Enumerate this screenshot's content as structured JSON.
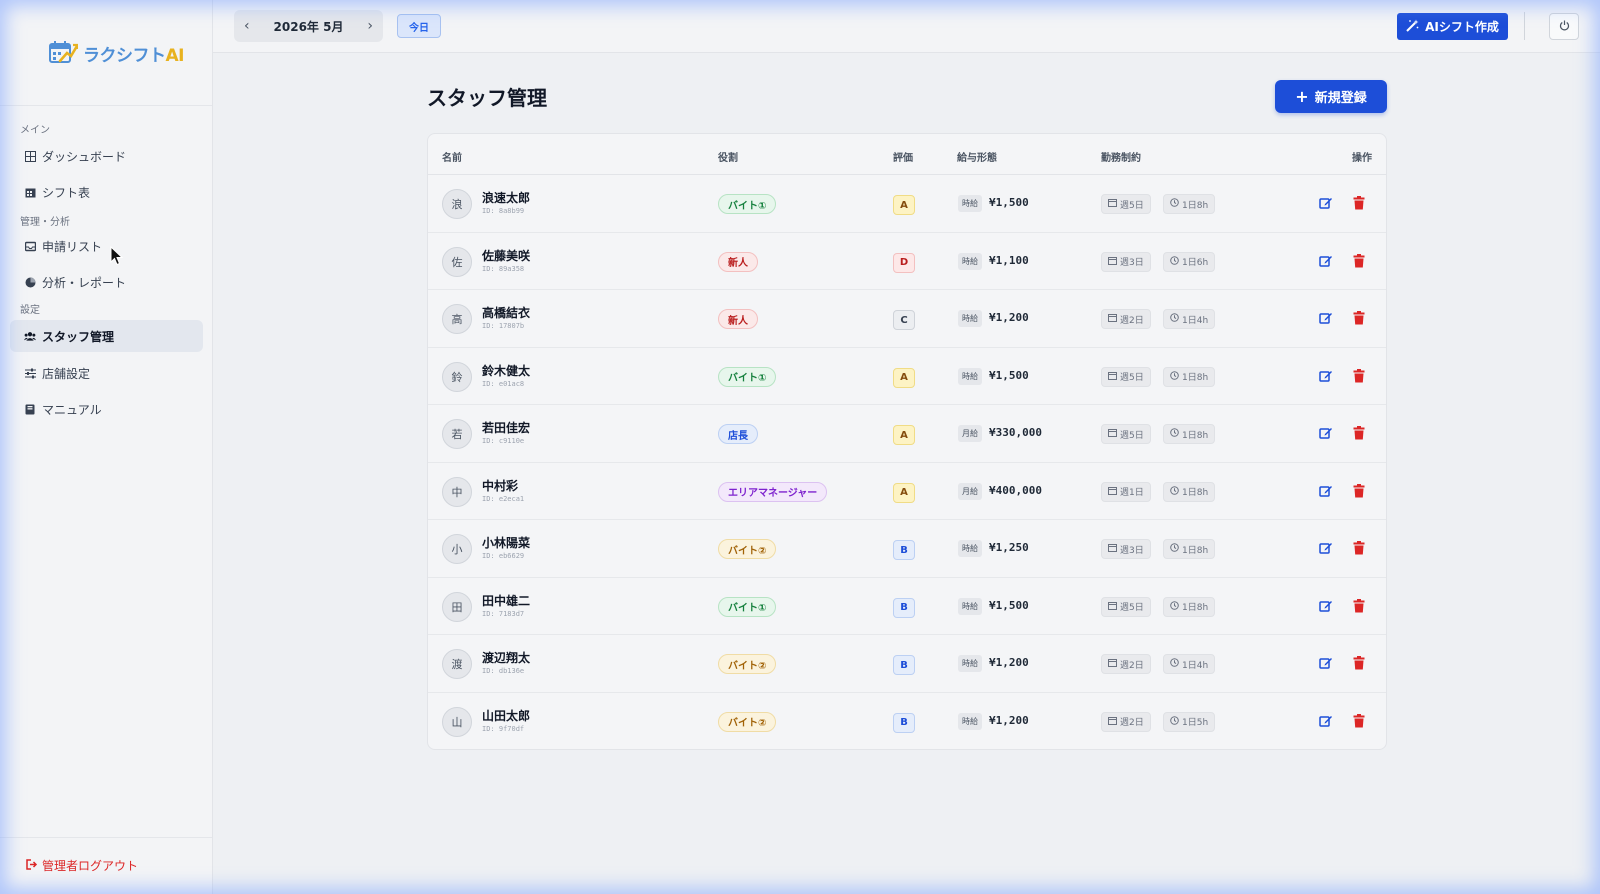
{
  "app": {
    "logo_text": "ラクシフト",
    "logo_ai": "AI"
  },
  "sidebar": {
    "sections": {
      "main": "メイン",
      "manage": "管理・分析",
      "settings": "設定"
    },
    "items": [
      {
        "label": "ダッシュボード",
        "icon": "dashboard-icon"
      },
      {
        "label": "シフト表",
        "icon": "calendar-icon"
      },
      {
        "label": "申請リスト",
        "icon": "inbox-icon"
      },
      {
        "label": "分析・レポート",
        "icon": "pie-chart-icon"
      },
      {
        "label": "スタッフ管理",
        "icon": "users-icon",
        "active": true
      },
      {
        "label": "店舗設定",
        "icon": "sliders-icon"
      },
      {
        "label": "マニュアル",
        "icon": "book-icon"
      }
    ],
    "logout": "管理者ログアウト"
  },
  "topbar": {
    "month": "2026年 5月",
    "today": "今日",
    "ai_button": "AIシフト作成",
    "power_icon": "power-icon"
  },
  "main": {
    "title": "スタッフ管理",
    "new_button": "新規登録",
    "columns": [
      "名前",
      "役割",
      "評価",
      "給与形態",
      "勤務制約",
      "操作"
    ],
    "rows": [
      {
        "initial": "浪",
        "name": "浪速太郎",
        "id": "ID: 8a8b99",
        "role": "バイト①",
        "role_style": "green",
        "grade": "A",
        "pay_type": "時給",
        "pay": "¥1,500",
        "days": "週5日",
        "hours": "1日8h"
      },
      {
        "initial": "佐",
        "name": "佐藤美咲",
        "id": "ID: 89a358",
        "role": "新人",
        "role_style": "red",
        "grade": "D",
        "pay_type": "時給",
        "pay": "¥1,100",
        "days": "週3日",
        "hours": "1日6h"
      },
      {
        "initial": "高",
        "name": "高橋結衣",
        "id": "ID: 17807b",
        "role": "新人",
        "role_style": "red",
        "grade": "C",
        "pay_type": "時給",
        "pay": "¥1,200",
        "days": "週2日",
        "hours": "1日4h"
      },
      {
        "initial": "鈴",
        "name": "鈴木健太",
        "id": "ID: e01ac8",
        "role": "バイト①",
        "role_style": "green",
        "grade": "A",
        "pay_type": "時給",
        "pay": "¥1,500",
        "days": "週5日",
        "hours": "1日8h"
      },
      {
        "initial": "若",
        "name": "若田佳宏",
        "id": "ID: c9110e",
        "role": "店長",
        "role_style": "blue",
        "grade": "A",
        "pay_type": "月給",
        "pay": "¥330,000",
        "days": "週5日",
        "hours": "1日8h"
      },
      {
        "initial": "中",
        "name": "中村彩",
        "id": "ID: e2eca1",
        "role": "エリアマネージャー",
        "role_style": "purple",
        "grade": "A",
        "pay_type": "月給",
        "pay": "¥400,000",
        "days": "週1日",
        "hours": "1日8h"
      },
      {
        "initial": "小",
        "name": "小林陽菜",
        "id": "ID: eb6629",
        "role": "バイト②",
        "role_style": "yellow",
        "grade": "B",
        "pay_type": "時給",
        "pay": "¥1,250",
        "days": "週3日",
        "hours": "1日8h"
      },
      {
        "initial": "田",
        "name": "田中雄二",
        "id": "ID: 7183d7",
        "role": "バイト①",
        "role_style": "green",
        "grade": "B",
        "pay_type": "時給",
        "pay": "¥1,500",
        "days": "週5日",
        "hours": "1日8h"
      },
      {
        "initial": "渡",
        "name": "渡辺翔太",
        "id": "ID: db136e",
        "role": "バイト②",
        "role_style": "yellow",
        "grade": "B",
        "pay_type": "時給",
        "pay": "¥1,200",
        "days": "週2日",
        "hours": "1日4h"
      },
      {
        "initial": "山",
        "name": "山田太郎",
        "id": "ID: 9f70df",
        "role": "バイト②",
        "role_style": "yellow",
        "grade": "B",
        "pay_type": "時給",
        "pay": "¥1,200",
        "days": "週2日",
        "hours": "1日5h"
      }
    ]
  },
  "colors": {
    "primary": "#1d4ed8",
    "danger": "#dc2626",
    "edit": "#1d4ed8"
  }
}
